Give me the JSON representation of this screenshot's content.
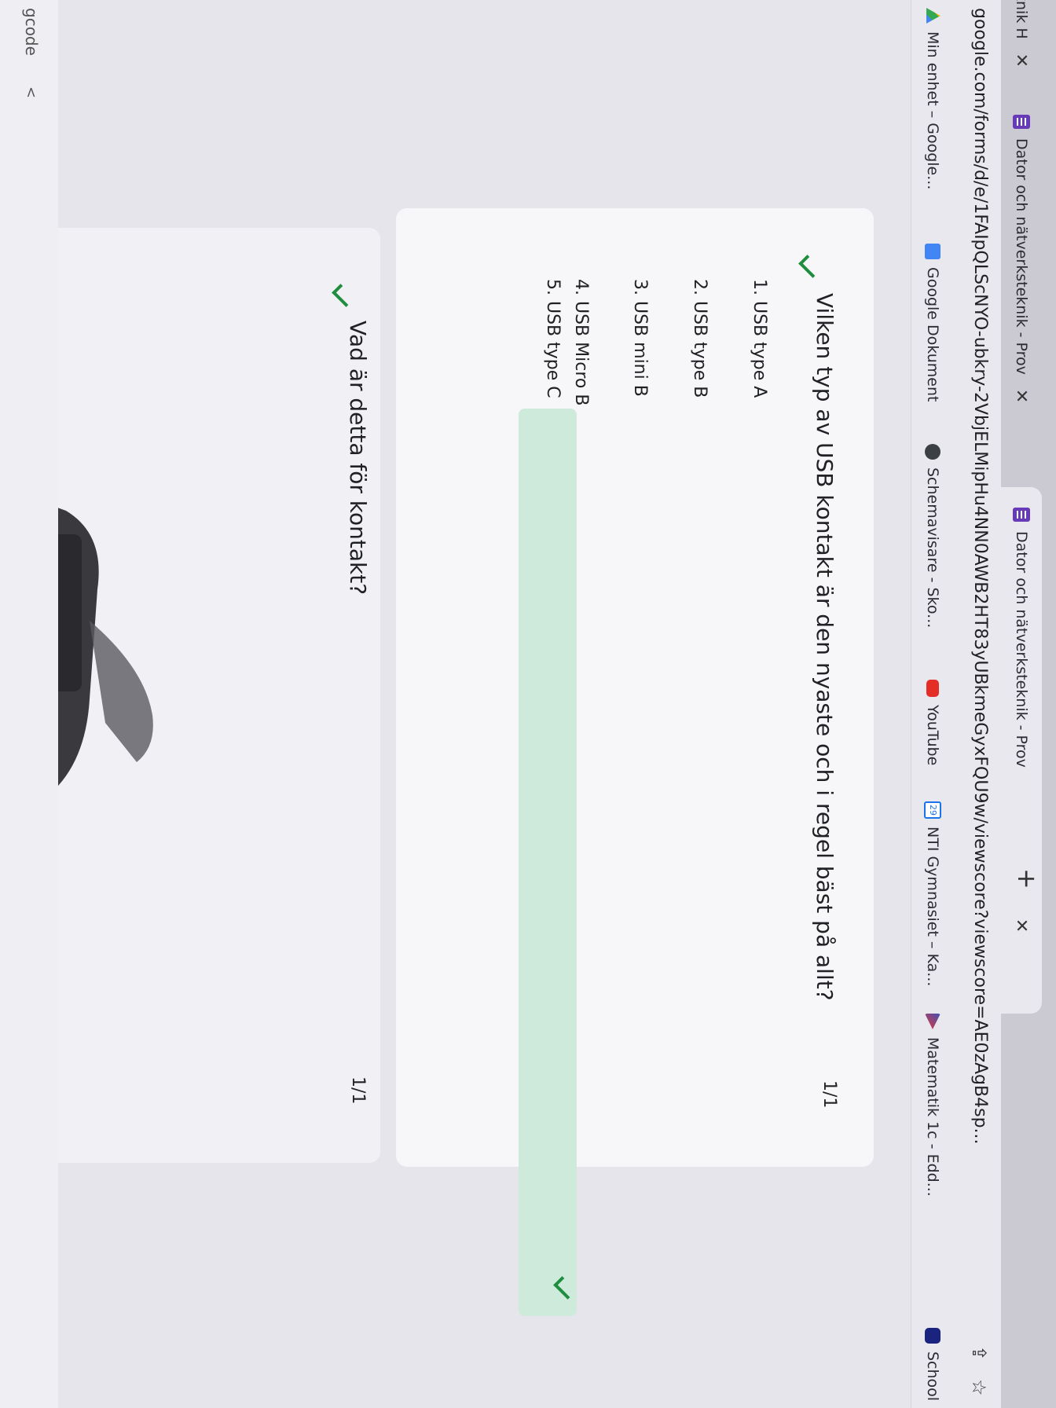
{
  "browser": {
    "tabs": [
      {
        "title": "knik H",
        "close": "✕"
      },
      {
        "title": "Dator och nätverksteknik - Prov",
        "close": "✕"
      },
      {
        "title": "Dator och nätverksteknik - Prov",
        "close": "✕"
      }
    ],
    "new_tab": "+",
    "url": "google.com/forms/d/e/1FAIpQLScNYO-ubkry-2VbjELMipHu4NN0AWB2HT83yUBkmeGyxFQU9w/viewscore?viewscore=AE0zAgB4sp...",
    "bookmarks": [
      {
        "label": "Min enhet – Google...",
        "icon": "drive-icon"
      },
      {
        "label": "Google Dokument",
        "icon": "docs-icon"
      },
      {
        "label": "Schemavisare - Sko...",
        "icon": "globe-icon"
      },
      {
        "label": "YouTube",
        "icon": "youtube-icon"
      },
      {
        "label": "NTI Gymnasiet – Ka...",
        "icon": "calendar-icon",
        "icon_text": "29"
      },
      {
        "label": "Matematik 1c - Edd...",
        "icon": "math-icon"
      },
      {
        "label": "School",
        "icon": "school-icon"
      }
    ]
  },
  "questions": [
    {
      "title": "Vilken typ av USB kontakt är den nyaste och i regel bäst på allt?",
      "score": "1/1",
      "options": [
        "1. USB type A",
        "2. USB type B",
        "3. USB mini B",
        "4. USB Micro B",
        "5. USB type C"
      ],
      "correct_index": 4
    },
    {
      "title": "Vad är detta för kontakt?",
      "score": "1/1"
    }
  ],
  "side_strip": {
    "label": "gcode",
    "chevron": "<"
  }
}
